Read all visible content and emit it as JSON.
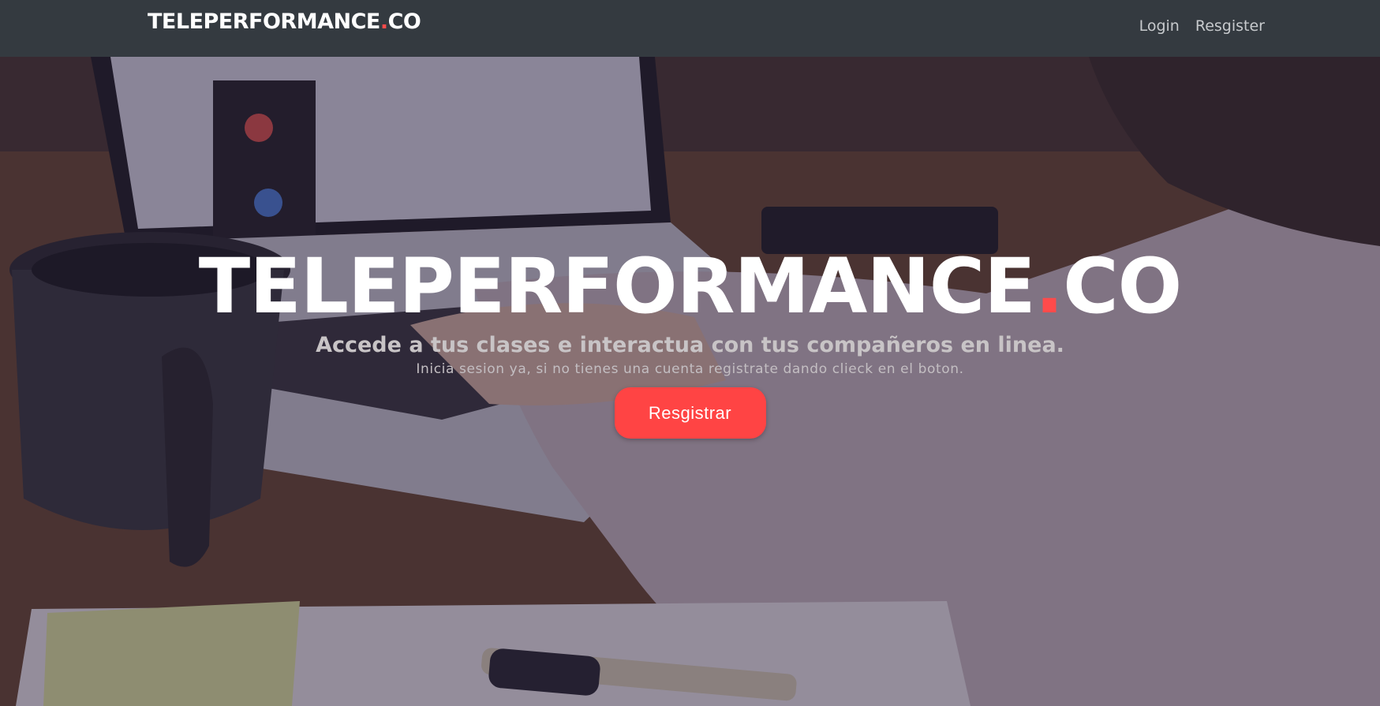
{
  "navbar": {
    "brand_main": "TELEPERFORMANCE",
    "brand_dot": ".",
    "brand_suffix": "CO",
    "links": [
      "Login",
      "Resgister"
    ]
  },
  "hero": {
    "title_main": "TELEPERFORMANCE",
    "title_dot": ".",
    "title_suffix": "CO",
    "subtitle": "Accede a tus clases e interactua con tus compañeros en linea.",
    "text": "Inicia sesion ya, si no tienes una cuenta registrate dando clieck en el boton.",
    "button_label": "Resgistrar"
  },
  "colors": {
    "navbar_bg": "#343a40",
    "accent": "#ff4444",
    "brand_text": "#ffffff"
  },
  "icons": {
    "hero_background": "photo-laptop-desk-person"
  }
}
